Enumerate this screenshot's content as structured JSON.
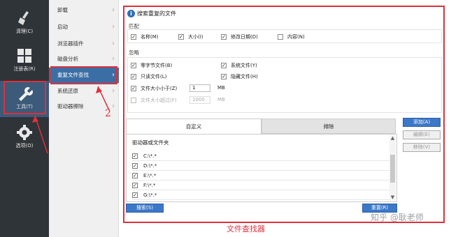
{
  "sidebar": {
    "items": [
      {
        "label": "清理(C)",
        "icon": "broom-icon"
      },
      {
        "label": "注册表(R)",
        "icon": "grid-icon"
      },
      {
        "label": "工具(T)",
        "icon": "wrench-icon"
      },
      {
        "label": "选项(O)",
        "icon": "gear-icon"
      }
    ]
  },
  "submenu": {
    "items": [
      "卸载",
      "启动",
      "浏览器插件",
      "磁盘分析",
      "重复文件查找",
      "系统还原",
      "驱动器擦除"
    ]
  },
  "panel": {
    "title": "搜索重复的文件",
    "match": {
      "label": "匹配",
      "options": [
        {
          "label": "名称(M)",
          "checked": true
        },
        {
          "label": "大小(I)",
          "checked": true
        },
        {
          "label": "修改日期(D)",
          "checked": true
        },
        {
          "label": "内容(N)",
          "checked": false
        }
      ]
    },
    "ignore": {
      "label": "忽略",
      "options": [
        {
          "label": "零字节文件(B)",
          "checked": true
        },
        {
          "label": "系统文件(Y)",
          "checked": true
        },
        {
          "label": "只读文件(L)",
          "checked": true
        },
        {
          "label": "隐藏文件(H)",
          "checked": true
        },
        {
          "label": "文件大小小于(Z)",
          "checked": true,
          "value": "1",
          "unit": "MB"
        },
        {
          "label": "文件大小超过(F)",
          "checked": false,
          "value": "1000",
          "unit": "MB"
        }
      ]
    },
    "tabs": [
      "自定义",
      "排除"
    ],
    "list": {
      "header": "驱动器或文件夹",
      "rows": [
        "C:\\*.*",
        "D:\\*.*",
        "E:\\*.*",
        "F:\\*.*",
        "G:\\*.*"
      ]
    },
    "buttons": {
      "add": "添加(A)",
      "edit": "编辑(E)",
      "remove": "移除(V)",
      "search": "搜索(S)",
      "reset": "重置(R)"
    }
  },
  "annotations": {
    "step_number": "2",
    "caption": "文件查找器",
    "watermark": "知乎 @耿老师"
  },
  "colors": {
    "sidebar": "#2f3439",
    "highlight": "#e0303a",
    "selection": "#3b6ea5",
    "button": "#3b78c7"
  }
}
